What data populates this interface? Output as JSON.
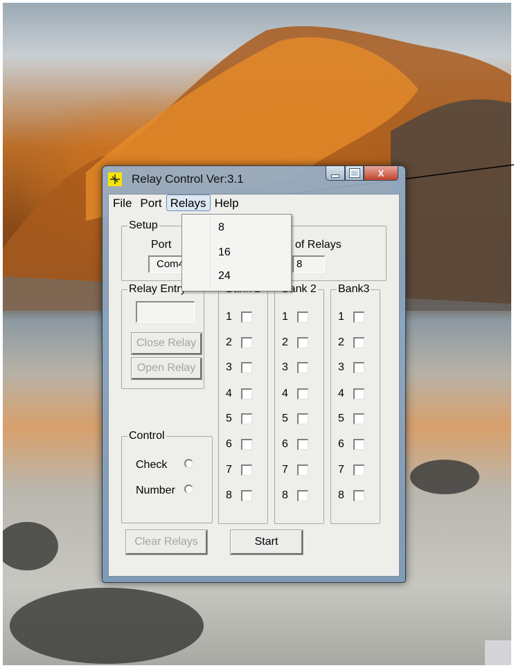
{
  "window": {
    "title": "Relay Control Ver:3.1",
    "controls": {
      "minimize": "minimize",
      "maximize": "maximize",
      "close": "X"
    }
  },
  "menubar": {
    "file": "File",
    "port": "Port",
    "relays": "Relays",
    "help": "Help"
  },
  "relays_menu": {
    "items": [
      "8",
      "16",
      "24"
    ]
  },
  "setup": {
    "legend": "Setup",
    "port_label": "Port",
    "port_value": "Com4",
    "relays_label": "of Relays",
    "relays_value": "8"
  },
  "relay_entry": {
    "legend": "Relay Entry",
    "input_value": "",
    "close_button": "Close Relay",
    "open_button": "Open Relay"
  },
  "control": {
    "legend": "Control",
    "check_label": "Check",
    "number_label": "Number"
  },
  "banks": [
    {
      "legend": "Bank 1",
      "rows": [
        "1",
        "2",
        "3",
        "4",
        "5",
        "6",
        "7",
        "8"
      ]
    },
    {
      "legend": "Bank 2",
      "rows": [
        "1",
        "2",
        "3",
        "4",
        "5",
        "6",
        "7",
        "8"
      ]
    },
    {
      "legend": "Bank3",
      "rows": [
        "1",
        "2",
        "3",
        "4",
        "5",
        "6",
        "7",
        "8"
      ]
    }
  ],
  "buttons": {
    "clear_relays": "Clear Relays",
    "start": "Start"
  },
  "colors": {
    "titlebar": "#9fb6cc",
    "dialog_bg": "#eeeeea",
    "close_button": "#c0442c",
    "app_icon": "#f6e40b"
  }
}
